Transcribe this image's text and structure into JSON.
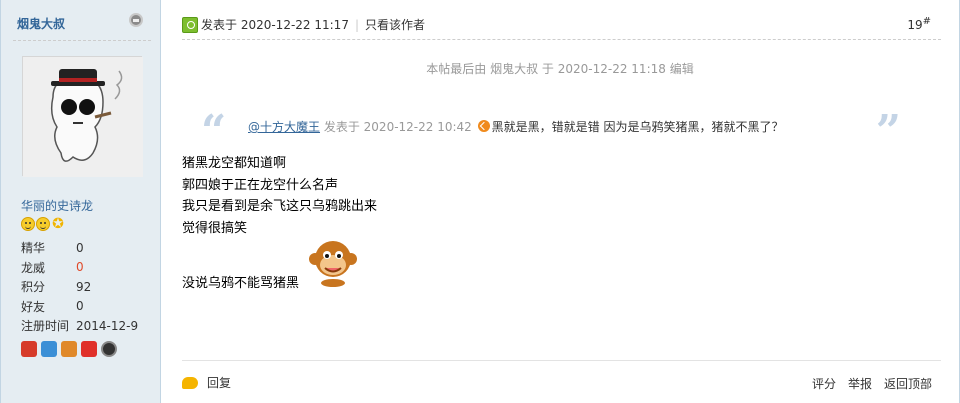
{
  "sidebar": {
    "author": "烟鬼大叔",
    "rank": "华丽的史诗龙",
    "stats": [
      {
        "label": "精华",
        "value": "0"
      },
      {
        "label": "龙威",
        "value": "0"
      },
      {
        "label": "积分",
        "value": "92"
      },
      {
        "label": "好友",
        "value": "0"
      },
      {
        "label": "注册时间",
        "value": "2014-12-9"
      }
    ]
  },
  "post": {
    "posted_label": "发表于 2020-12-22 11:17",
    "only_author": "只看该作者",
    "floor": "19",
    "floor_sup": "#",
    "edited_note": "本帖最后由 烟鬼大叔 于 2020-12-22 11:18 编辑",
    "quote": {
      "user": "@十方大魔王",
      "meta": "发表于 2020-12-22 10:42",
      "text": "黑就是黑，错就是错 因为是乌鸦笑猪黑，猪就不黑了？"
    },
    "lines": [
      "猪黑龙空都知道啊",
      "郭四娘于正在龙空什么名声",
      "我只是看到是余飞这只乌鸦跳出来",
      "觉得很搞笑"
    ],
    "last_line": "没说乌鸦不能骂猪黑"
  },
  "footer": {
    "reply": "回复",
    "rate": "评分",
    "report": "举报",
    "back_top": "返回顶部"
  }
}
